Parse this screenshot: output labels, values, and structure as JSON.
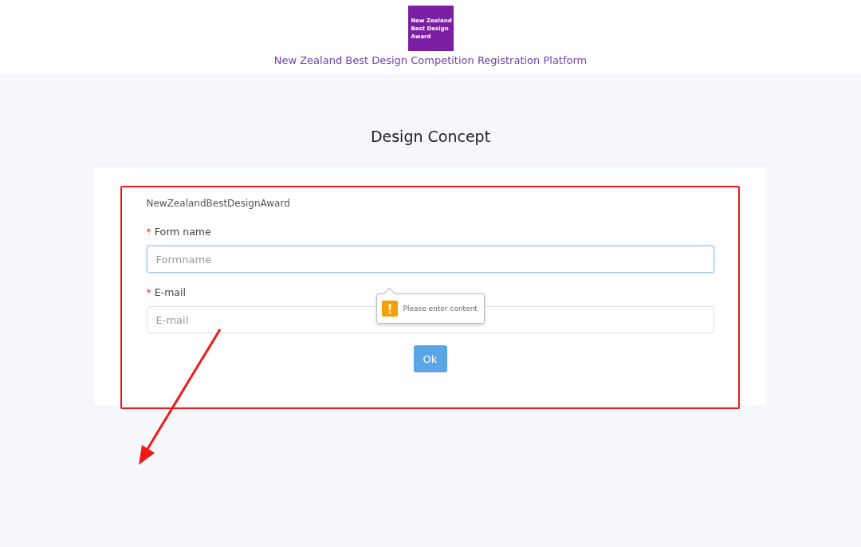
{
  "header": {
    "logo_lines": [
      "New Zealand",
      "Best Design",
      "Award"
    ],
    "platform_title": "New Zealand Best Design Competition Registration Platform"
  },
  "page_title": "Design Concept",
  "form": {
    "group_label": "NewZealandBestDesignAward",
    "fields": [
      {
        "required_mark": "*",
        "label": "Form name",
        "placeholder": "Formname",
        "focused": true,
        "error": "Please enter content"
      },
      {
        "required_mark": "*",
        "label": "E-mail",
        "placeholder": "E-mail",
        "focused": false
      }
    ],
    "submit": "Ok"
  }
}
